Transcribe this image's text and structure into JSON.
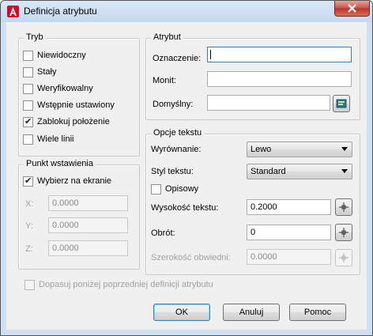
{
  "window": {
    "title": "Definicja atrybutu"
  },
  "mode": {
    "title": "Tryb",
    "items": [
      {
        "label": "Niewidoczny",
        "checked": false
      },
      {
        "label": "Stały",
        "checked": false
      },
      {
        "label": "Weryfikowalny",
        "checked": false
      },
      {
        "label": "Wstępnie ustawiony",
        "checked": false
      },
      {
        "label": "Zablokuj położenie",
        "checked": true
      },
      {
        "label": "Wiele linii",
        "checked": false
      }
    ]
  },
  "attribute": {
    "title": "Atrybut",
    "tag_label": "Oznaczenie:",
    "tag_value": "",
    "prompt_label": "Monit:",
    "prompt_value": "",
    "default_label": "Domyślny:",
    "default_value": ""
  },
  "insertion": {
    "title": "Punkt wstawienia",
    "specify_label": "Wybierz na ekranie",
    "specify_checked": true,
    "x_label": "X:",
    "x_value": "0.0000",
    "y_label": "Y:",
    "y_value": "0.0000",
    "z_label": "Z:",
    "z_value": "0.0000"
  },
  "text": {
    "title": "Opcje tekstu",
    "justification_label": "Wyrównanie:",
    "justification_value": "Lewo",
    "style_label": "Styl tekstu:",
    "style_value": "Standard",
    "annotative_label": "Opisowy",
    "annotative_checked": false,
    "height_label": "Wysokość tekstu:",
    "height_value": "0.2000",
    "rotation_label": "Obrót:",
    "rotation_value": "0",
    "boundary_label": "Szerokość obwiedni:",
    "boundary_value": "0.0000"
  },
  "align_below": {
    "label": "Dopasuj poniżej poprzedniej definicji atrybutu",
    "checked": false
  },
  "buttons": {
    "ok": "OK",
    "cancel": "Anuluj",
    "help": "Pomoc"
  }
}
